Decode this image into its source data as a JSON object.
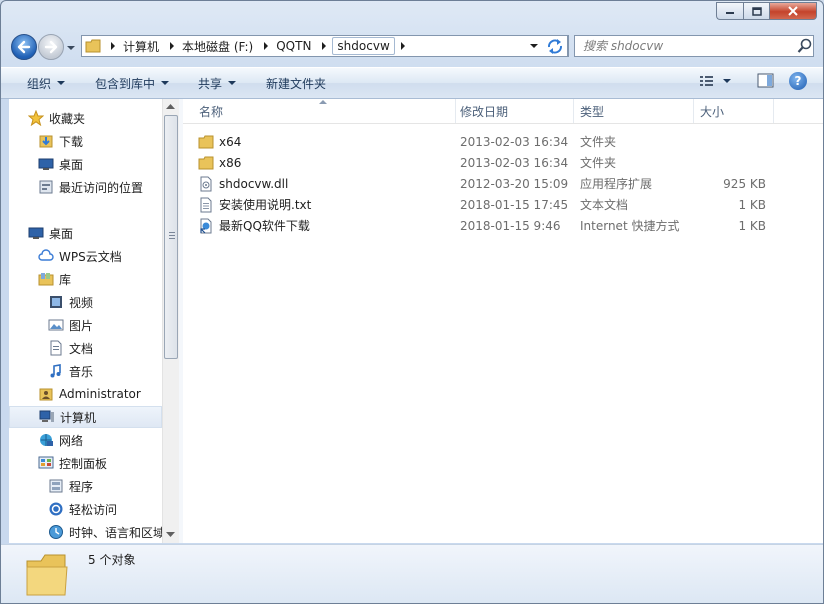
{
  "window": {
    "caption": {
      "minimize_icon": "minimize-icon",
      "maximize_icon": "maximize-icon",
      "close_icon": "close-icon"
    }
  },
  "nav": {
    "breadcrumbs": [
      {
        "label": "计算机"
      },
      {
        "label": "本地磁盘 (F:)"
      },
      {
        "label": "QQTN"
      },
      {
        "label": "shdocvw"
      }
    ],
    "search_placeholder": "搜索 shdocvw"
  },
  "toolbar": {
    "organize": "组织",
    "include_in_library": "包含到库中",
    "share": "共享",
    "new_folder": "新建文件夹"
  },
  "sidebar": {
    "items": [
      {
        "label": "收藏夹",
        "icon": "star-icon"
      },
      {
        "label": "下载",
        "icon": "downloads-icon"
      },
      {
        "label": "桌面",
        "icon": "desktop-icon"
      },
      {
        "label": "最近访问的位置",
        "icon": "recent-places-icon"
      },
      {
        "label": "桌面",
        "icon": "desktop-icon"
      },
      {
        "label": "WPS云文档",
        "icon": "cloud-icon"
      },
      {
        "label": "库",
        "icon": "library-icon"
      },
      {
        "label": "视频",
        "icon": "video-icon"
      },
      {
        "label": "图片",
        "icon": "pictures-icon"
      },
      {
        "label": "文档",
        "icon": "documents-icon"
      },
      {
        "label": "音乐",
        "icon": "music-icon"
      },
      {
        "label": "Administrator",
        "icon": "user-folder-icon"
      },
      {
        "label": "计算机",
        "icon": "computer-icon",
        "selected": true
      },
      {
        "label": "网络",
        "icon": "network-icon"
      },
      {
        "label": "控制面板",
        "icon": "control-panel-icon"
      },
      {
        "label": "程序",
        "icon": "programs-icon"
      },
      {
        "label": "轻松访问",
        "icon": "ease-of-access-icon"
      },
      {
        "label": "时钟、语言和区域",
        "icon": "clock-language-icon"
      }
    ]
  },
  "columns": {
    "name": "名称",
    "modified": "修改日期",
    "type": "类型",
    "size": "大小"
  },
  "files": [
    {
      "name": "x64",
      "date": "2013-02-03 16:34",
      "type": "文件夹",
      "size": "",
      "icon": "folder-icon"
    },
    {
      "name": "x86",
      "date": "2013-02-03 16:34",
      "type": "文件夹",
      "size": "",
      "icon": "folder-icon"
    },
    {
      "name": "shdocvw.dll",
      "date": "2012-03-20 15:09",
      "type": "应用程序扩展",
      "size": "925 KB",
      "icon": "dll-file-icon"
    },
    {
      "name": "安装使用说明.txt",
      "date": "2018-01-15 17:45",
      "type": "文本文档",
      "size": "1 KB",
      "icon": "text-file-icon"
    },
    {
      "name": "最新QQ软件下载",
      "date": "2018-01-15 9:46",
      "type": "Internet 快捷方式",
      "size": "1 KB",
      "icon": "internet-shortcut-icon"
    }
  ],
  "status": {
    "count": "5 个对象"
  },
  "colors": {
    "accent": "#1f5fb4",
    "folder": "#e9c35a",
    "selected_bg": "#e4ecf6"
  }
}
